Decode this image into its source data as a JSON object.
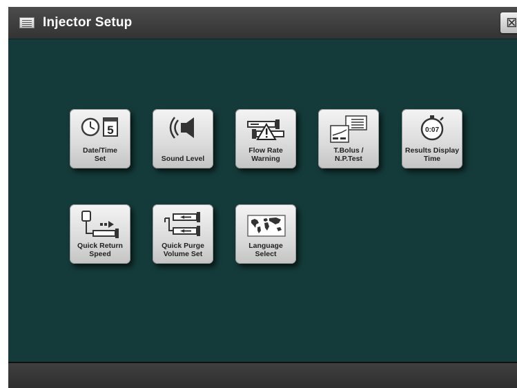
{
  "window": {
    "title": "Injector Setup",
    "close_glyph": "⊠"
  },
  "tiles": [
    {
      "label": "Date/Time\nSet",
      "icon": "clock-calendar-icon",
      "calendar_day": "5"
    },
    {
      "label": "Sound Level",
      "icon": "speaker-icon"
    },
    {
      "label": "Flow Rate\nWarning",
      "icon": "flow-warning-icon"
    },
    {
      "label": "T.Bolus /\nN.P.Test",
      "icon": "test-chart-icon"
    },
    {
      "label": "Results Display\nTime",
      "icon": "stopwatch-icon",
      "stopwatch_text": "0:07"
    },
    {
      "label": "Quick Return\nSpeed",
      "icon": "return-syringe-icon"
    },
    {
      "label": "Quick Purge\nVolume Set",
      "icon": "purge-syringe-icon"
    },
    {
      "label": "Language\nSelect",
      "icon": "world-map-icon"
    }
  ],
  "colors": {
    "content_bg": "#143b3a",
    "titlebar": "#3a3a3a",
    "tile": "#dcdcdc"
  }
}
